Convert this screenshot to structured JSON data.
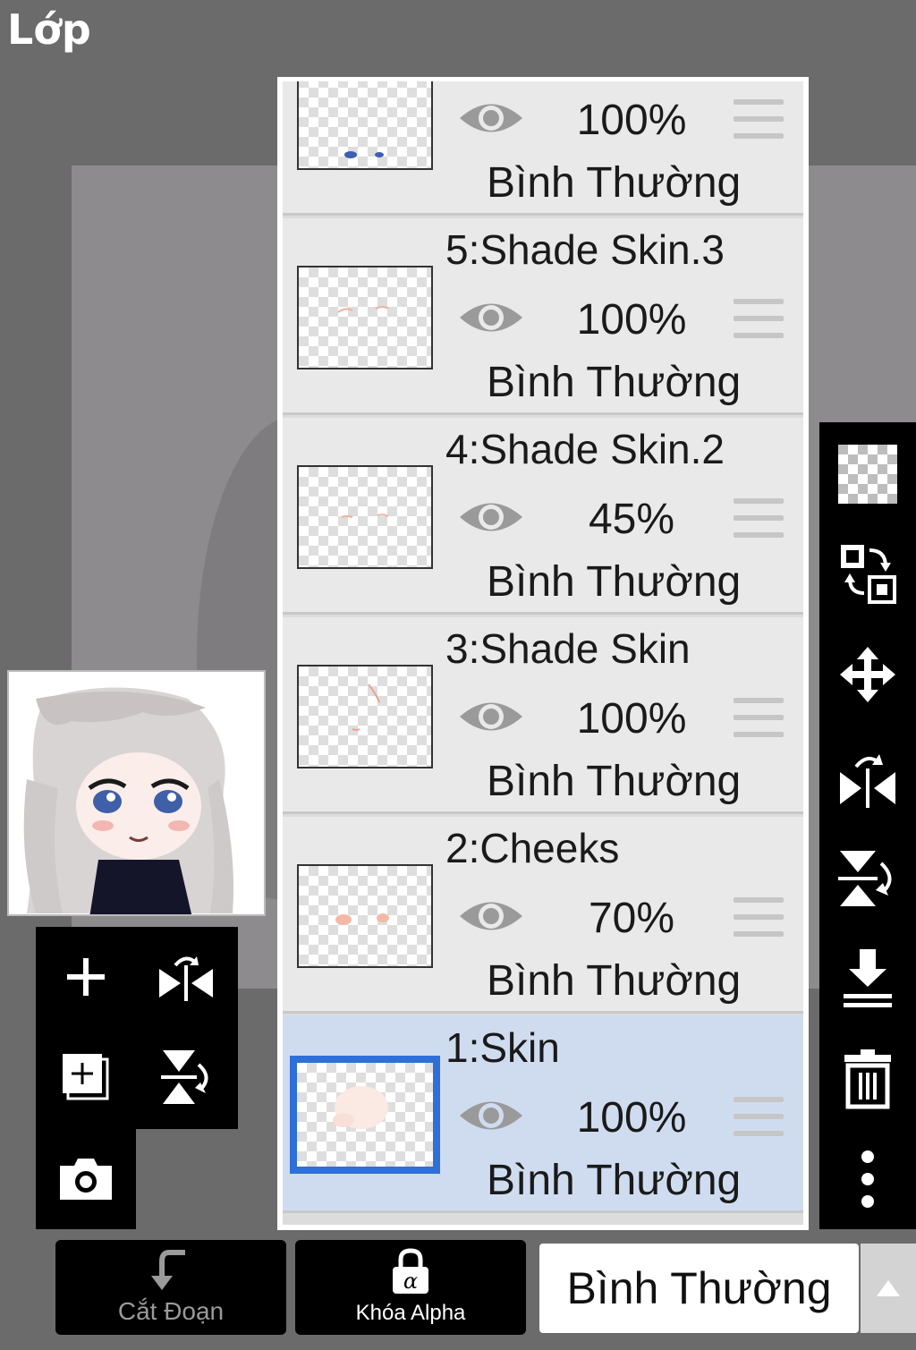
{
  "header": {
    "title": "Lớp"
  },
  "layers": [
    {
      "name": "",
      "opacity": "100%",
      "blend": "Bình Thường",
      "selected": false
    },
    {
      "name": "5:Shade Skin.3",
      "opacity": "100%",
      "blend": "Bình Thường",
      "selected": false
    },
    {
      "name": "4:Shade Skin.2",
      "opacity": "45%",
      "blend": "Bình Thường",
      "selected": false
    },
    {
      "name": "3:Shade Skin",
      "opacity": "100%",
      "blend": "Bình Thường",
      "selected": false
    },
    {
      "name": "2:Cheeks",
      "opacity": "70%",
      "blend": "Bình Thường",
      "selected": false
    },
    {
      "name": "1:Skin",
      "opacity": "100%",
      "blend": "Bình Thường",
      "selected": true
    }
  ],
  "bottom_bar": {
    "clip_label": "Cắt Đoạn",
    "alpha_lock_label": "Khóa Alpha",
    "blend_mode_value": "Bình Thường"
  },
  "colors": {
    "selected_row": "#cfdcf0",
    "selected_border": "#2f6fd8",
    "panel_bg": "#e9e9e9"
  },
  "icons": {
    "right_toolbar": [
      "transparent-grid-icon",
      "swap-layers-icon",
      "move-icon",
      "flip-horizontal-icon",
      "flip-vertical-icon",
      "merge-down-icon",
      "trash-icon",
      "more-vertical-icon"
    ],
    "left_toolbar": [
      "add-layer-icon",
      "flip-layer-horizontal-icon",
      "add-new-layer-icon",
      "flip-layer-vertical-icon",
      "camera-icon"
    ]
  }
}
